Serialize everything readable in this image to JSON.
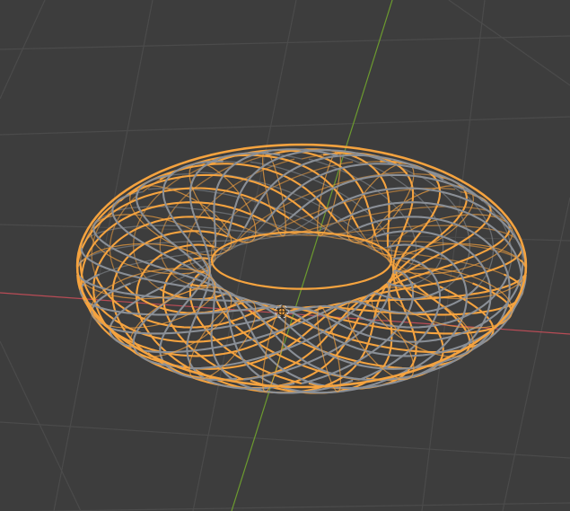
{
  "viewport": {
    "background_color": "#3d3d3d",
    "grid_color": "#4b4b4b",
    "x_axis_color": "#b94c56",
    "y_axis_color": "#6c9b2f",
    "selection_color": "#f5a33f",
    "wire_color": "#8a8f96"
  },
  "object": {
    "type": "torus",
    "display": "wireframe",
    "selected": true
  },
  "icons": {
    "object_origin": "object-origin-icon",
    "cursor_3d": "3d-cursor-icon"
  }
}
